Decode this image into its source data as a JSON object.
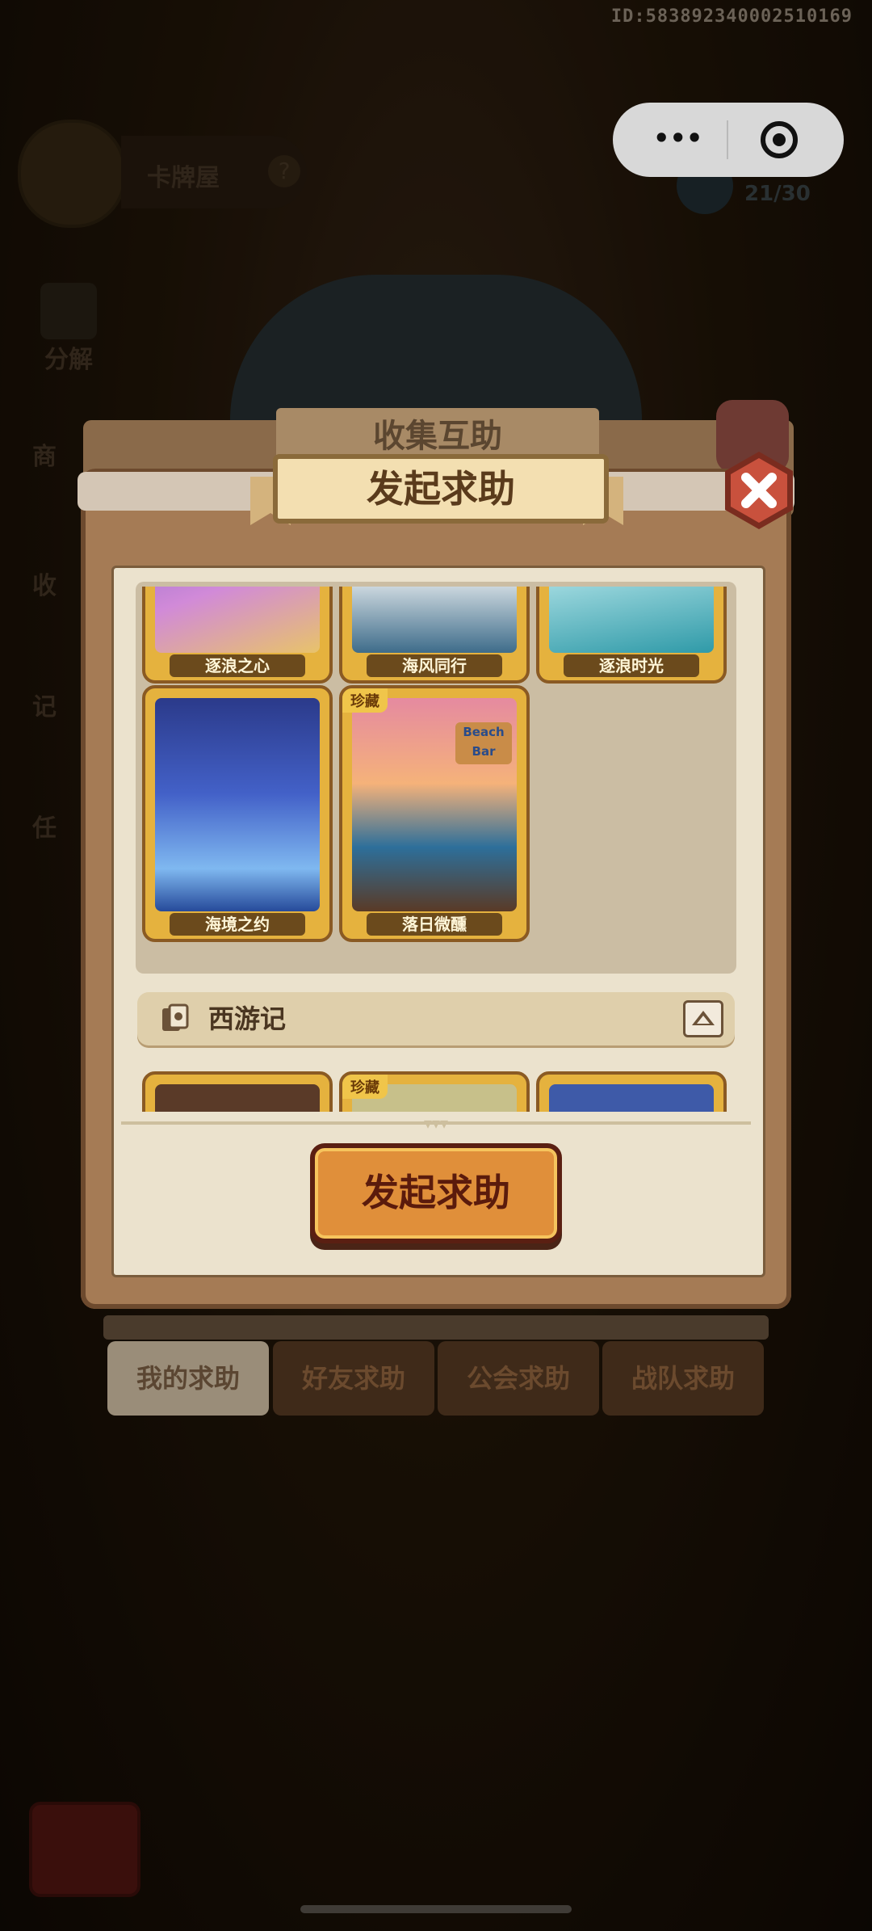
{
  "system": {
    "user_id": "ID:583892340002510169"
  },
  "background": {
    "screen_title": "卡牌屋",
    "side_menu": [
      "分解",
      "商",
      "收",
      "记",
      "任"
    ],
    "progress_text": "21/30"
  },
  "back_dialog": {
    "title": "收集互助"
  },
  "dialog": {
    "title": "发起求助",
    "cards_row1": [
      {
        "name": "逐浪之心",
        "rare": ""
      },
      {
        "name": "海风同行",
        "rare": ""
      },
      {
        "name": "逐浪时光",
        "rare": ""
      }
    ],
    "cards_row2": [
      {
        "name": "海境之约",
        "rare": ""
      },
      {
        "name": "落日微醺",
        "rare": "珍藏"
      }
    ],
    "beach_sign": {
      "line1": "Beach",
      "line2": "Bar"
    },
    "section": {
      "title": "西游记"
    },
    "section_cards_rare": "珍藏",
    "submit_button": "发起求助"
  },
  "tabs": [
    "我的求助",
    "好友求助",
    "公会求助",
    "战队求助"
  ],
  "colors": {
    "gold": "#e5b23e",
    "panel": "#ebe2cd",
    "button": "#e08f3a",
    "close_red": "#c9513d"
  }
}
